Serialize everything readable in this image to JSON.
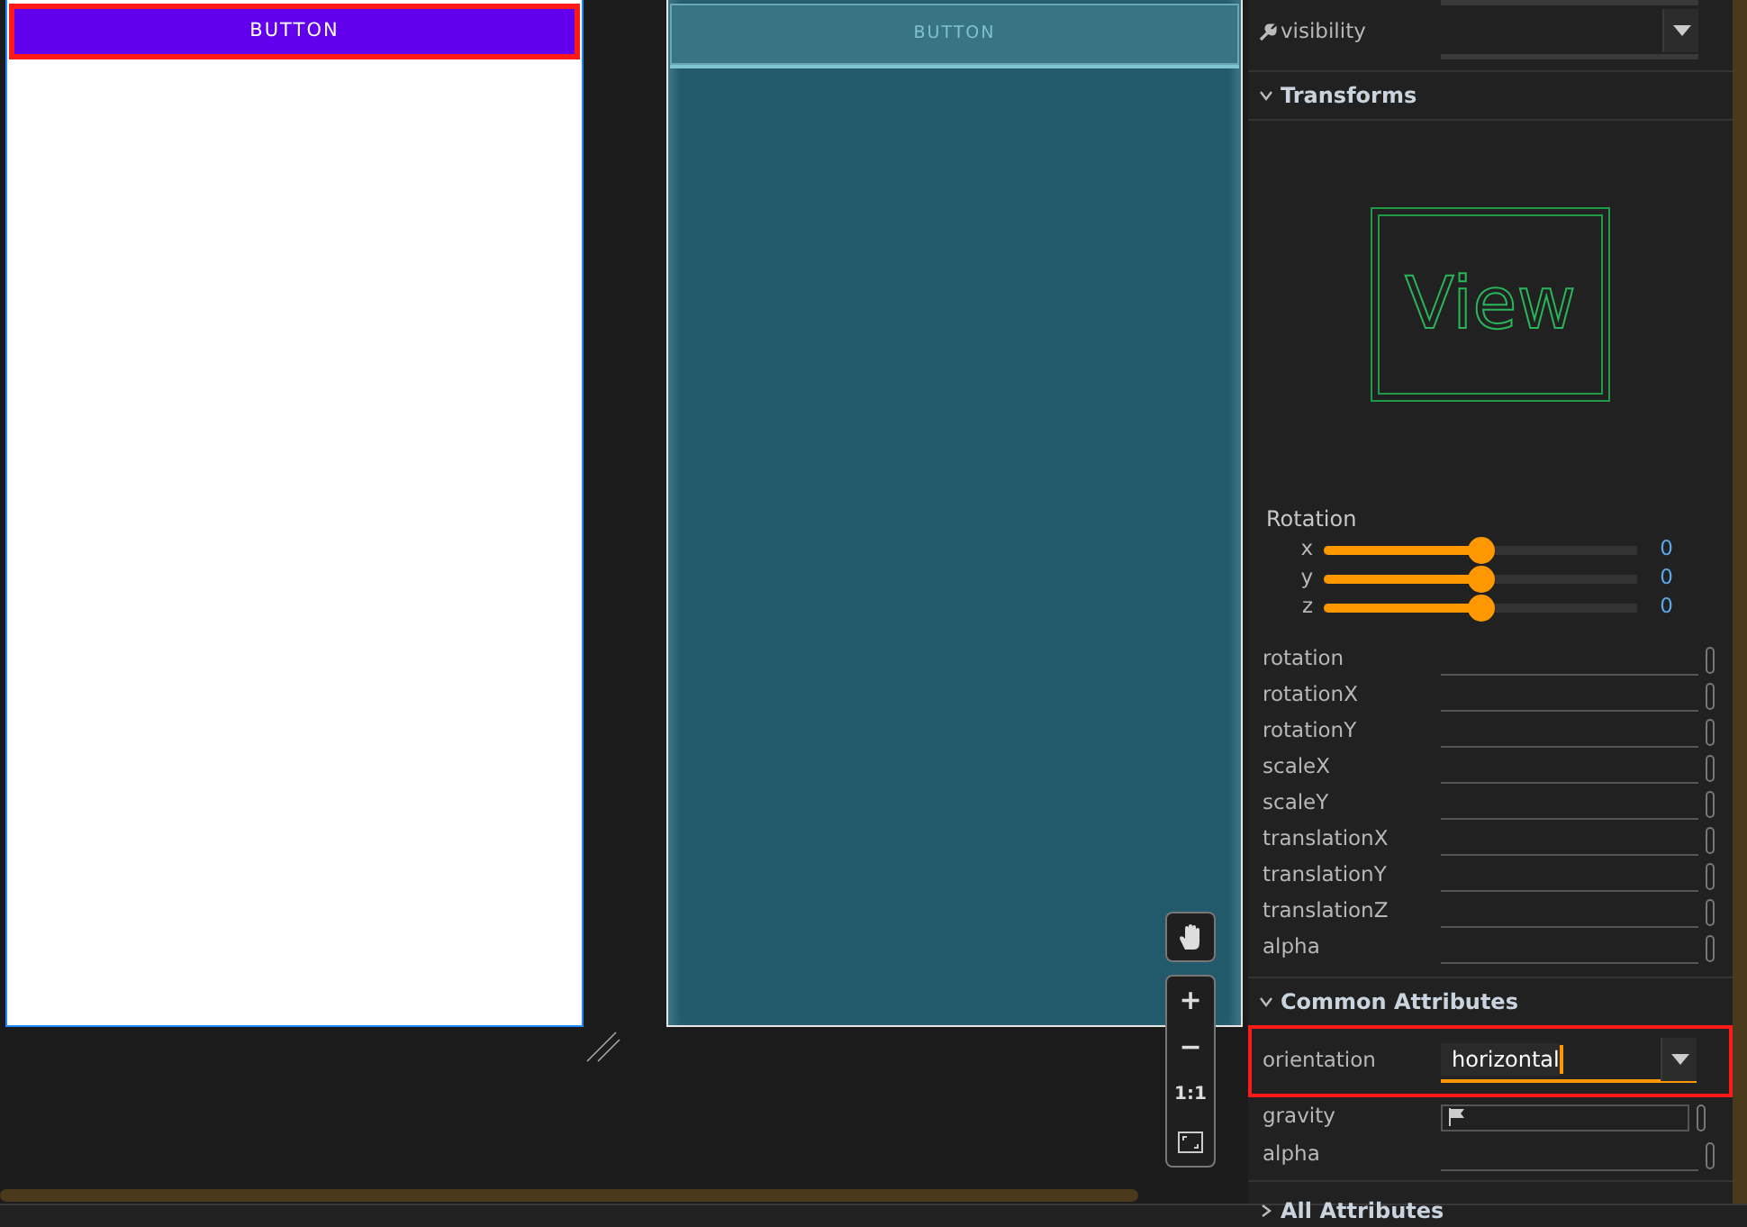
{
  "design_preview": {
    "button_label": "BUTTON",
    "selected": true
  },
  "blueprint_preview": {
    "button_label": "BUTTON"
  },
  "zoom_controls": [
    "+",
    "−",
    "1:1"
  ],
  "attributes": {
    "visibility_label": "visibility",
    "transforms": {
      "title": "Transforms",
      "expanded": true,
      "preview_label": "View",
      "rotation_title": "Rotation",
      "sliders": [
        {
          "axis": "x",
          "level": 0.5,
          "reading": "0"
        },
        {
          "axis": "y",
          "level": 0.5,
          "reading": "0"
        },
        {
          "axis": "z",
          "level": 0.5,
          "reading": "0"
        }
      ],
      "fields": [
        "rotation",
        "rotationX",
        "rotationY",
        "scaleX",
        "scaleY",
        "translationX",
        "translationY",
        "translationZ",
        "alpha"
      ]
    },
    "common": {
      "title": "Common Attributes",
      "expanded": true,
      "rows": [
        {
          "kind": "dropdown",
          "label": "orientation",
          "value": "horizontal",
          "highlighted": true
        },
        {
          "kind": "flag",
          "label": "gravity",
          "highlighted": false
        },
        {
          "kind": "text",
          "label": "alpha",
          "highlighted": false
        }
      ]
    },
    "all": {
      "title": "All Attributes",
      "expanded": false
    }
  }
}
